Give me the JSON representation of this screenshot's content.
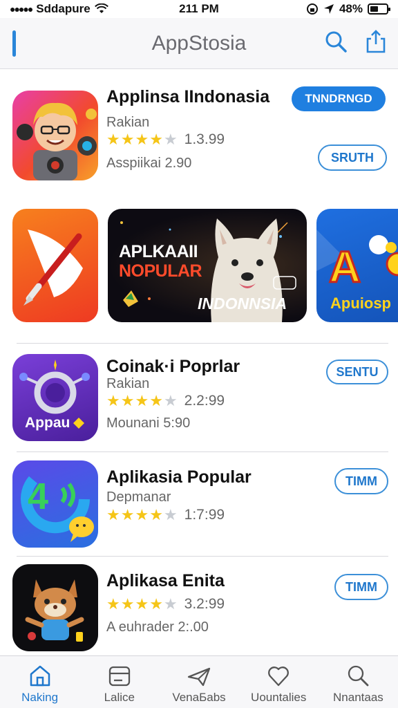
{
  "status_bar": {
    "carrier": "Sddapure",
    "time": "211 PM",
    "battery_text": "48%",
    "battery_level": 0.48
  },
  "nav": {
    "title": "AppStosia"
  },
  "featured": {
    "title": "Applinsa IIndonasia",
    "subtitle": "Rakian",
    "rating": 4,
    "rating_text": "1.3.99",
    "price_text": "Asspiikai 2.90",
    "primary_button": "TNNDRNGD",
    "secondary_button": "SRUTH"
  },
  "carousel": {
    "banner_line1": "APLKAAII",
    "banner_line2": "NOPULAR",
    "banner_bottom": "INDONNSIA",
    "third_text": "Apuiosp"
  },
  "apps": [
    {
      "title": "Coinak·i Poprlar",
      "subtitle": "Rakian",
      "rating": 4,
      "rating_text": "2.2:99",
      "price_text": "Mounani 5:90",
      "button": "SENTU",
      "icon_text": "Appau"
    },
    {
      "title": "Aplikasia Popular",
      "subtitle": "Depmanar",
      "rating": 4,
      "rating_text": "1:7:99",
      "price_text": "",
      "button": "TIMM",
      "icon_text": "4"
    },
    {
      "title": "Aplikasa Enita",
      "subtitle": "",
      "rating": 4,
      "rating_text": "3.2:99",
      "price_text": "A euhrader 2:.00",
      "button": "TIMM",
      "icon_text": ""
    }
  ],
  "tabs": [
    {
      "label": "Naking",
      "icon": "home-icon",
      "active": true
    },
    {
      "label": "Lalice",
      "icon": "wallet-icon",
      "active": false
    },
    {
      "label": "VenaБabs",
      "icon": "paper-plane-icon",
      "active": false
    },
    {
      "label": "Uountalies",
      "icon": "heart-icon",
      "active": false
    },
    {
      "label": "Nnantaas",
      "icon": "search-icon",
      "active": false
    }
  ],
  "colors": {
    "accent": "#1f7fe0",
    "star": "#f5c518"
  }
}
